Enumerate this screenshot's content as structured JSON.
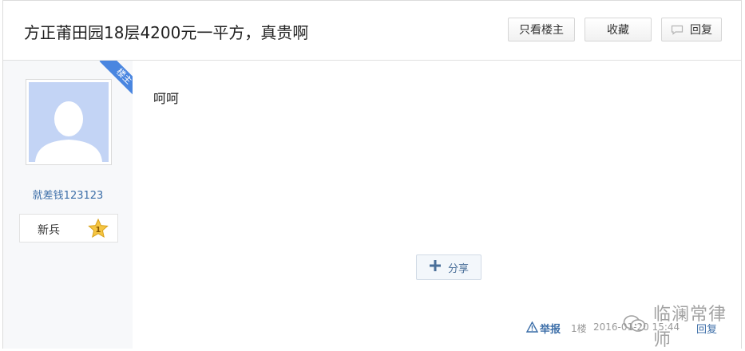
{
  "header": {
    "title": "方正莆田园18层4200元一平方，真贵啊",
    "only_author_label": "只看楼主",
    "favorite_label": "收藏",
    "reply_label": "回复"
  },
  "author": {
    "badge": "楼主",
    "username": "就差钱123123",
    "level_name": "新兵",
    "level": "1"
  },
  "post": {
    "content": "呵呵",
    "share_label": "分享",
    "report_label": "举报",
    "floor": "1楼",
    "time": "2016-01-20 15:44",
    "reply_label": "回复"
  },
  "watermark": {
    "text": "临澜常律师"
  },
  "colors": {
    "link": "#3c6ea8",
    "ribbon": "#4a86e0",
    "avatar_bg": "#c3d4f5",
    "star": "#f5c542"
  }
}
